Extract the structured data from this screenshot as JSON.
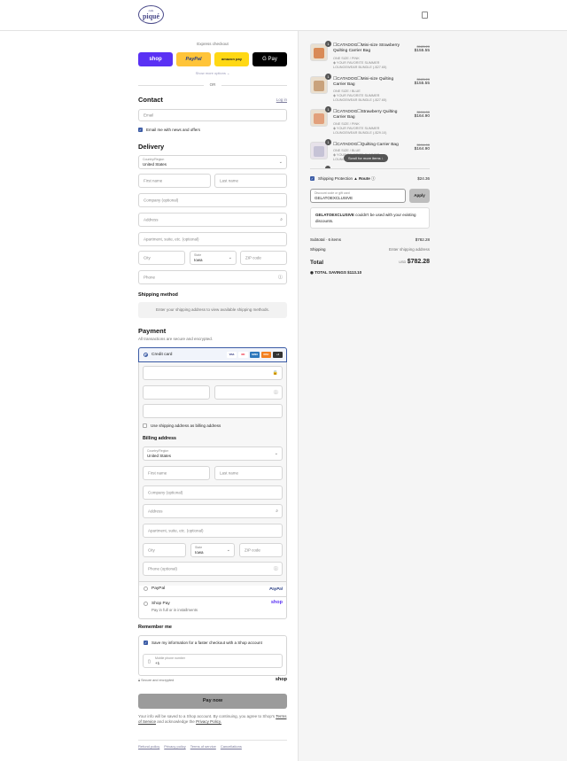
{
  "header": {
    "logo_small": "cafe",
    "logo_text": "piqué"
  },
  "express": {
    "title": "Express checkout",
    "shop_label": "shop",
    "paypal_label": "PayPal",
    "amazon_label": "amazon pay",
    "gpay_label": "G Pay",
    "more": "Show more options ⌄",
    "or": "OR"
  },
  "contact": {
    "title": "Contact",
    "login": "Log in",
    "email_placeholder": "Email",
    "news_label": "Email me with news and offers"
  },
  "delivery": {
    "title": "Delivery",
    "country_label": "Country/Region",
    "country_value": "United States",
    "first_name": "First name",
    "last_name": "Last name",
    "company": "Company (optional)",
    "address": "Address",
    "apartment": "Apartment, suite, etc. (optional)",
    "city": "City",
    "state_label": "State",
    "state_value": "Iowa",
    "zip": "ZIP code",
    "phone": "Phone"
  },
  "shipping_method": {
    "title": "Shipping method",
    "message": "Enter your shipping address to view available shipping methods."
  },
  "payment": {
    "title": "Payment",
    "subtitle": "All transactions are secure and encrypted.",
    "credit_card": "Credit card",
    "card_logos": [
      "VISA",
      "MC",
      "AMEX",
      "DISC",
      "+4"
    ],
    "use_shipping": "Use shipping address as billing address",
    "billing_title": "Billing address",
    "billing_phone": "Phone (optional)",
    "paypal_option": "PayPal",
    "paypal_logo": "PayPal",
    "shoppay_option": "Shop Pay",
    "shoppay_sub": "Pay in full or in installments",
    "shoppay_logo": "shop"
  },
  "remember": {
    "title": "Remember me",
    "save_label": "Save my information for a faster checkout with a Shop account",
    "mobile_label": "Mobile phone number",
    "mobile_value": "+1",
    "secure": "Secure and encrypted",
    "shop_logo": "shop"
  },
  "pay_now": "Pay now",
  "legal": {
    "line1": "Your info will be saved to a Shop account. By continuing, you agree to Shop's",
    "terms": "Terms of Service",
    "and": "and acknowledge the",
    "privacy": "Privacy Policy."
  },
  "footer_links": [
    "Refund policy",
    "Privacy policy",
    "Terms of service",
    "Cancellations"
  ],
  "order": {
    "items": [
      {
        "qty": "1",
        "name": "☐CATADOG☐Mini-size Strawberry Quilting Carrier Bag",
        "variant": "ONE SIZE / PINK",
        "bundle": "YOUR FAVORITE SUMMER LOUNGEWEAR BUNDLE (-$27.65)",
        "old_price": "$183.20",
        "price": "$155.55"
      },
      {
        "qty": "1",
        "name": "☐CATADOG☐Mini-size Quilting Carrier Bag",
        "variant": "ONE SIZE / BLUE",
        "bundle": "YOUR FAVORITE SUMMER LOUNGEWEAR BUNDLE (-$27.65)",
        "old_price": "$183.20",
        "price": "$155.55"
      },
      {
        "qty": "1",
        "name": "☐CATADOG☐Strawberry Quilting Carrier Bag",
        "variant": "ONE SIZE / PINK",
        "bundle": "YOUR FAVORITE SUMMER LOUNGEWEAR BUNDLE (-$29.10)",
        "old_price": "$194.00",
        "price": "$164.90"
      },
      {
        "qty": "1",
        "name": "☐CATADOG☐Quilting Carrier Bag",
        "variant": "ONE SIZE / BLUE",
        "bundle": "YOUR FAVORITE SUMMER LOUNGEWEAR BUNDLE (-$29.10)",
        "old_price": "$194.00",
        "price": "$164.90"
      }
    ],
    "scroll_hint": "Scroll for more items ↓",
    "protection_label": "Shipping Protection",
    "route": "Route",
    "protection_price": "$24.36",
    "discount_label": "Discount code or gift card",
    "discount_value": "GELATOEXCLUSIVE",
    "apply": "Apply",
    "error_code": "GELATOEXCLUSIVE",
    "error_text": " couldn't be used with your existing discounts.",
    "subtotal_label": "Subtotal · 6 items",
    "subtotal": "$782.28",
    "shipping_label": "Shipping",
    "shipping_value": "Enter shipping address",
    "total_label": "Total",
    "currency": "USD",
    "total": "$782.28",
    "savings": "TOTAL SAVINGS  $113.10"
  }
}
